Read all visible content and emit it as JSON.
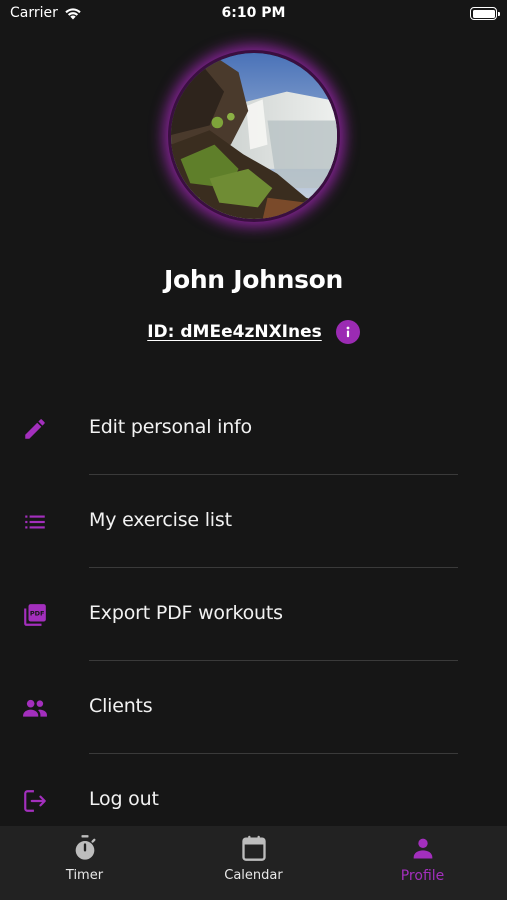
{
  "status_bar": {
    "carrier": "Carrier",
    "time": "6:10 PM"
  },
  "profile": {
    "name": "John Johnson",
    "id": "ID: dMEe4zNXInes"
  },
  "menu": [
    {
      "label": "Edit personal info",
      "icon": "pencil-icon"
    },
    {
      "label": "My exercise list",
      "icon": "list-icon"
    },
    {
      "label": "Export PDF workouts",
      "icon": "pdf-icon"
    },
    {
      "label": "Clients",
      "icon": "people-icon"
    },
    {
      "label": "Log out",
      "icon": "logout-icon"
    }
  ],
  "tabs": [
    {
      "label": "Timer",
      "icon": "stopwatch-icon"
    },
    {
      "label": "Calendar",
      "icon": "calendar-icon"
    },
    {
      "label": "Profile",
      "icon": "person-icon",
      "active": true
    }
  ],
  "colors": {
    "accent": "#a32fbd",
    "background": "#161616",
    "tab_bar": "#222222"
  }
}
